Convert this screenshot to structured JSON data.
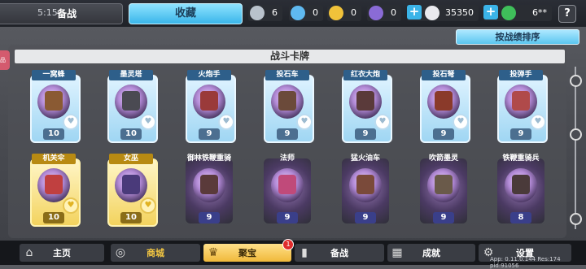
{
  "topbar": {
    "clock": "5:15",
    "tab_prepare": "备战",
    "tab_collection": "收藏",
    "currencies": [
      {
        "name": "silver-chest",
        "value": "6",
        "color": "#b9c2cc"
      },
      {
        "name": "blue-chest",
        "value": "0",
        "color": "#5fb9f0"
      },
      {
        "name": "gold-chest",
        "value": "0",
        "color": "#f0c23a"
      },
      {
        "name": "purple-chest",
        "value": "0",
        "color": "#8a6bd6"
      }
    ],
    "coins": "35350",
    "gems": "6**",
    "help_label": "?"
  },
  "sort_button": "按战绩排序",
  "section_title": "战斗卡牌",
  "side_tab": "品",
  "cards": [
    {
      "name": "一窝蜂",
      "level": "10",
      "style": "blue",
      "unit": "#8a5a33"
    },
    {
      "name": "墨灵塔",
      "level": "10",
      "style": "blue",
      "unit": "#4a4a52"
    },
    {
      "name": "火炮手",
      "level": "9",
      "style": "blue",
      "unit": "#9a3a3a"
    },
    {
      "name": "投石车",
      "level": "9",
      "style": "blue",
      "unit": "#6b4a3a"
    },
    {
      "name": "红衣大炮",
      "level": "9",
      "style": "blue",
      "unit": "#5a3a3a"
    },
    {
      "name": "投石弩",
      "level": "9",
      "style": "blue",
      "unit": "#8a3a2a"
    },
    {
      "name": "投弹手",
      "level": "9",
      "style": "blue",
      "unit": "#b04a4a"
    },
    {
      "name": "机关伞",
      "level": "10",
      "style": "gold",
      "unit": "#c04040"
    },
    {
      "name": "女巫",
      "level": "10",
      "style": "gold",
      "unit": "#4a3a7a"
    },
    {
      "name": "御林铁鞭重骑兵",
      "level": "9",
      "style": "dark",
      "unit": "#5a3a3a"
    },
    {
      "name": "法师",
      "level": "9",
      "style": "dark",
      "unit": "#c04a7a"
    },
    {
      "name": "猛火油车",
      "level": "9",
      "style": "dark",
      "unit": "#7a4a3a"
    },
    {
      "name": "吹箭墨灵",
      "level": "9",
      "style": "dark",
      "unit": "#6a5a4a"
    },
    {
      "name": "铁鞭重骑兵",
      "level": "8",
      "style": "dark",
      "unit": "#4a3a3a"
    }
  ],
  "nav": [
    {
      "label": "主页",
      "icon": "home-icon",
      "active": false
    },
    {
      "label": "商城",
      "icon": "shop-icon",
      "active": false
    },
    {
      "label": "聚宝",
      "icon": "treasure-icon",
      "active": true
    },
    {
      "label": "备战",
      "icon": "prepare-icon",
      "active": false
    },
    {
      "label": "成就",
      "icon": "achievement-icon",
      "active": false
    },
    {
      "label": "设置",
      "icon": "gear-icon",
      "active": false
    }
  ],
  "nav_badge": "1",
  "version": "App: 0.11.0.144 Res:174 pid:91056"
}
